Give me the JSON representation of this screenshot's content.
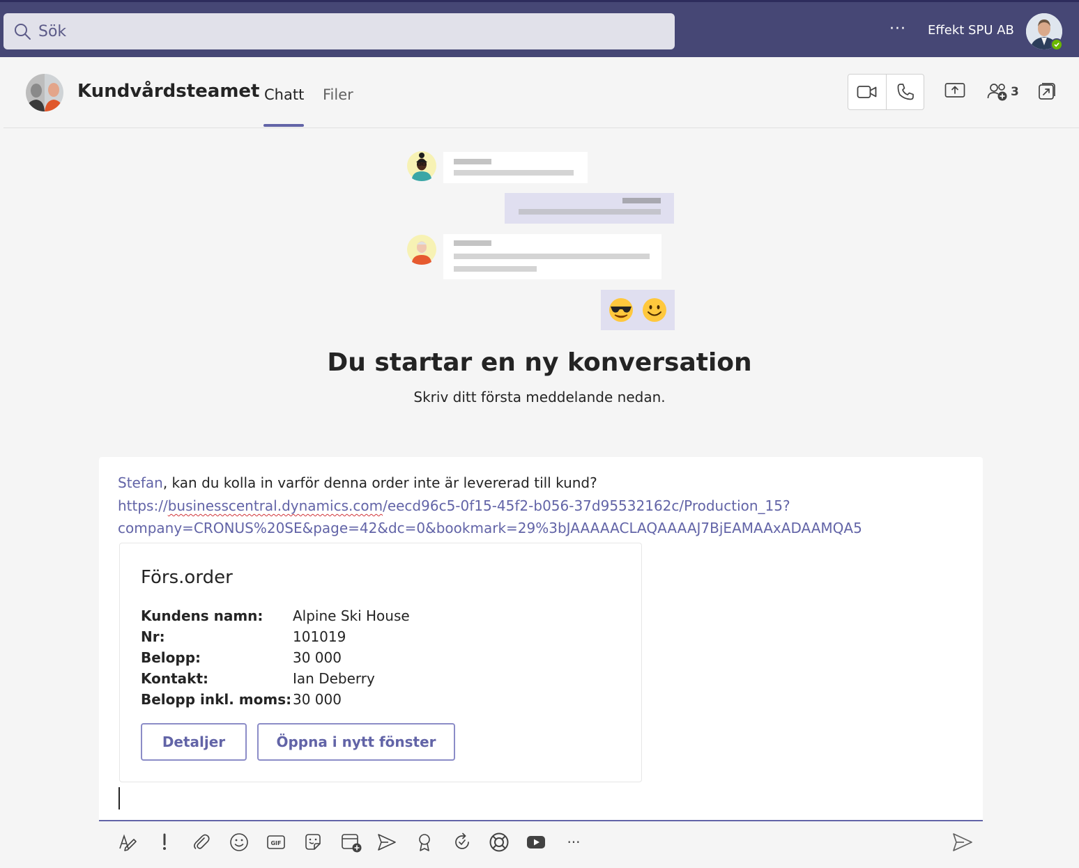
{
  "topbar": {
    "search_placeholder": "Sök",
    "more_label": "···",
    "org_name": "Effekt SPU AB",
    "presence_status": "available"
  },
  "header": {
    "team_name": "Kundvårdsteamet",
    "tabs": [
      {
        "label": "Chatt",
        "active": true
      },
      {
        "label": "Filer",
        "active": false
      }
    ],
    "participant_count": "3"
  },
  "empty_state": {
    "title": "Du startar en ny konversation",
    "subtitle": "Skriv ditt första meddelande nedan.",
    "emojis": [
      "😎",
      "🙂"
    ]
  },
  "compose": {
    "mention": "Stefan",
    "message_text": ", kan du kolla in varför denna order inte är levererad till kund?",
    "link_prefix": "https://",
    "link_domain": "businesscentral.dynamics.com",
    "link_path": "/eecd96c5-0f15-45f2-b056-37d95532162c/Production_15?",
    "link_query": "company=CRONUS%20SE&page=42&dc=0&bookmark=29%3bJAAAAACLAQAAAAJ7BjEAMAAxADAAMQA5",
    "card": {
      "title": "Förs.order",
      "facts": [
        {
          "label": "Kundens namn:",
          "value": "Alpine Ski House"
        },
        {
          "label": "Nr:",
          "value": "101019"
        },
        {
          "label": "Belopp:",
          "value": "30 000"
        },
        {
          "label": "Kontakt:",
          "value": "Ian Deberry"
        },
        {
          "label": "Belopp inkl. moms:",
          "value": "30 000"
        }
      ],
      "details_button": "Detaljer",
      "open_button": "Öppna i nytt fönster"
    }
  },
  "toolbar": {
    "more_label": "···"
  },
  "colors": {
    "accent": "#6264a7",
    "topbar": "#464775",
    "search_bg": "#e1e1ea",
    "self_bubble": "#e0dff0",
    "presence": "#6bb700"
  }
}
